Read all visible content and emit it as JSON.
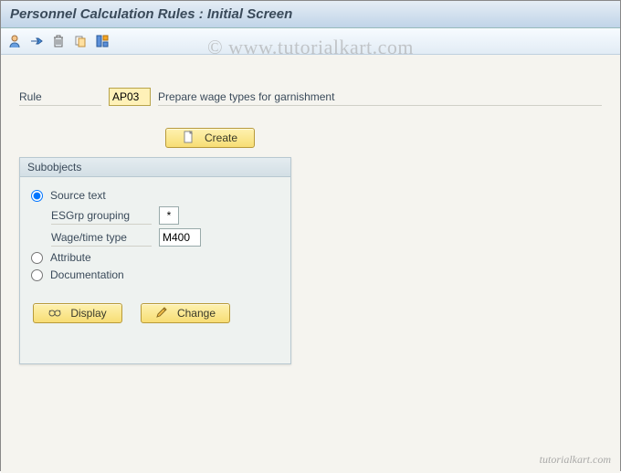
{
  "title": "Personnel Calculation Rules : Initial Screen",
  "watermark": "© www.tutorialkart.com",
  "footer": "tutorialkart.com",
  "toolbar": {
    "icons": [
      "user-icon",
      "transport-icon",
      "delete-icon",
      "copy-icon",
      "layout-icon"
    ]
  },
  "rule": {
    "label": "Rule",
    "value": "AP03",
    "description": "Prepare wage types for garnishment"
  },
  "buttons": {
    "create": "Create",
    "display": "Display",
    "change": "Change"
  },
  "subobjects": {
    "title": "Subobjects",
    "source_text": {
      "label": "Source text",
      "esgrp": {
        "label": "ESGrp grouping",
        "value": "*"
      },
      "wagetype": {
        "label": "Wage/time type",
        "value": "M400"
      }
    },
    "attribute": {
      "label": "Attribute"
    },
    "documentation": {
      "label": "Documentation"
    }
  },
  "colors": {
    "accent_button": "#f7dd74",
    "panel_bg": "#f5f4ef",
    "title_grad": "#c0d4e8"
  }
}
